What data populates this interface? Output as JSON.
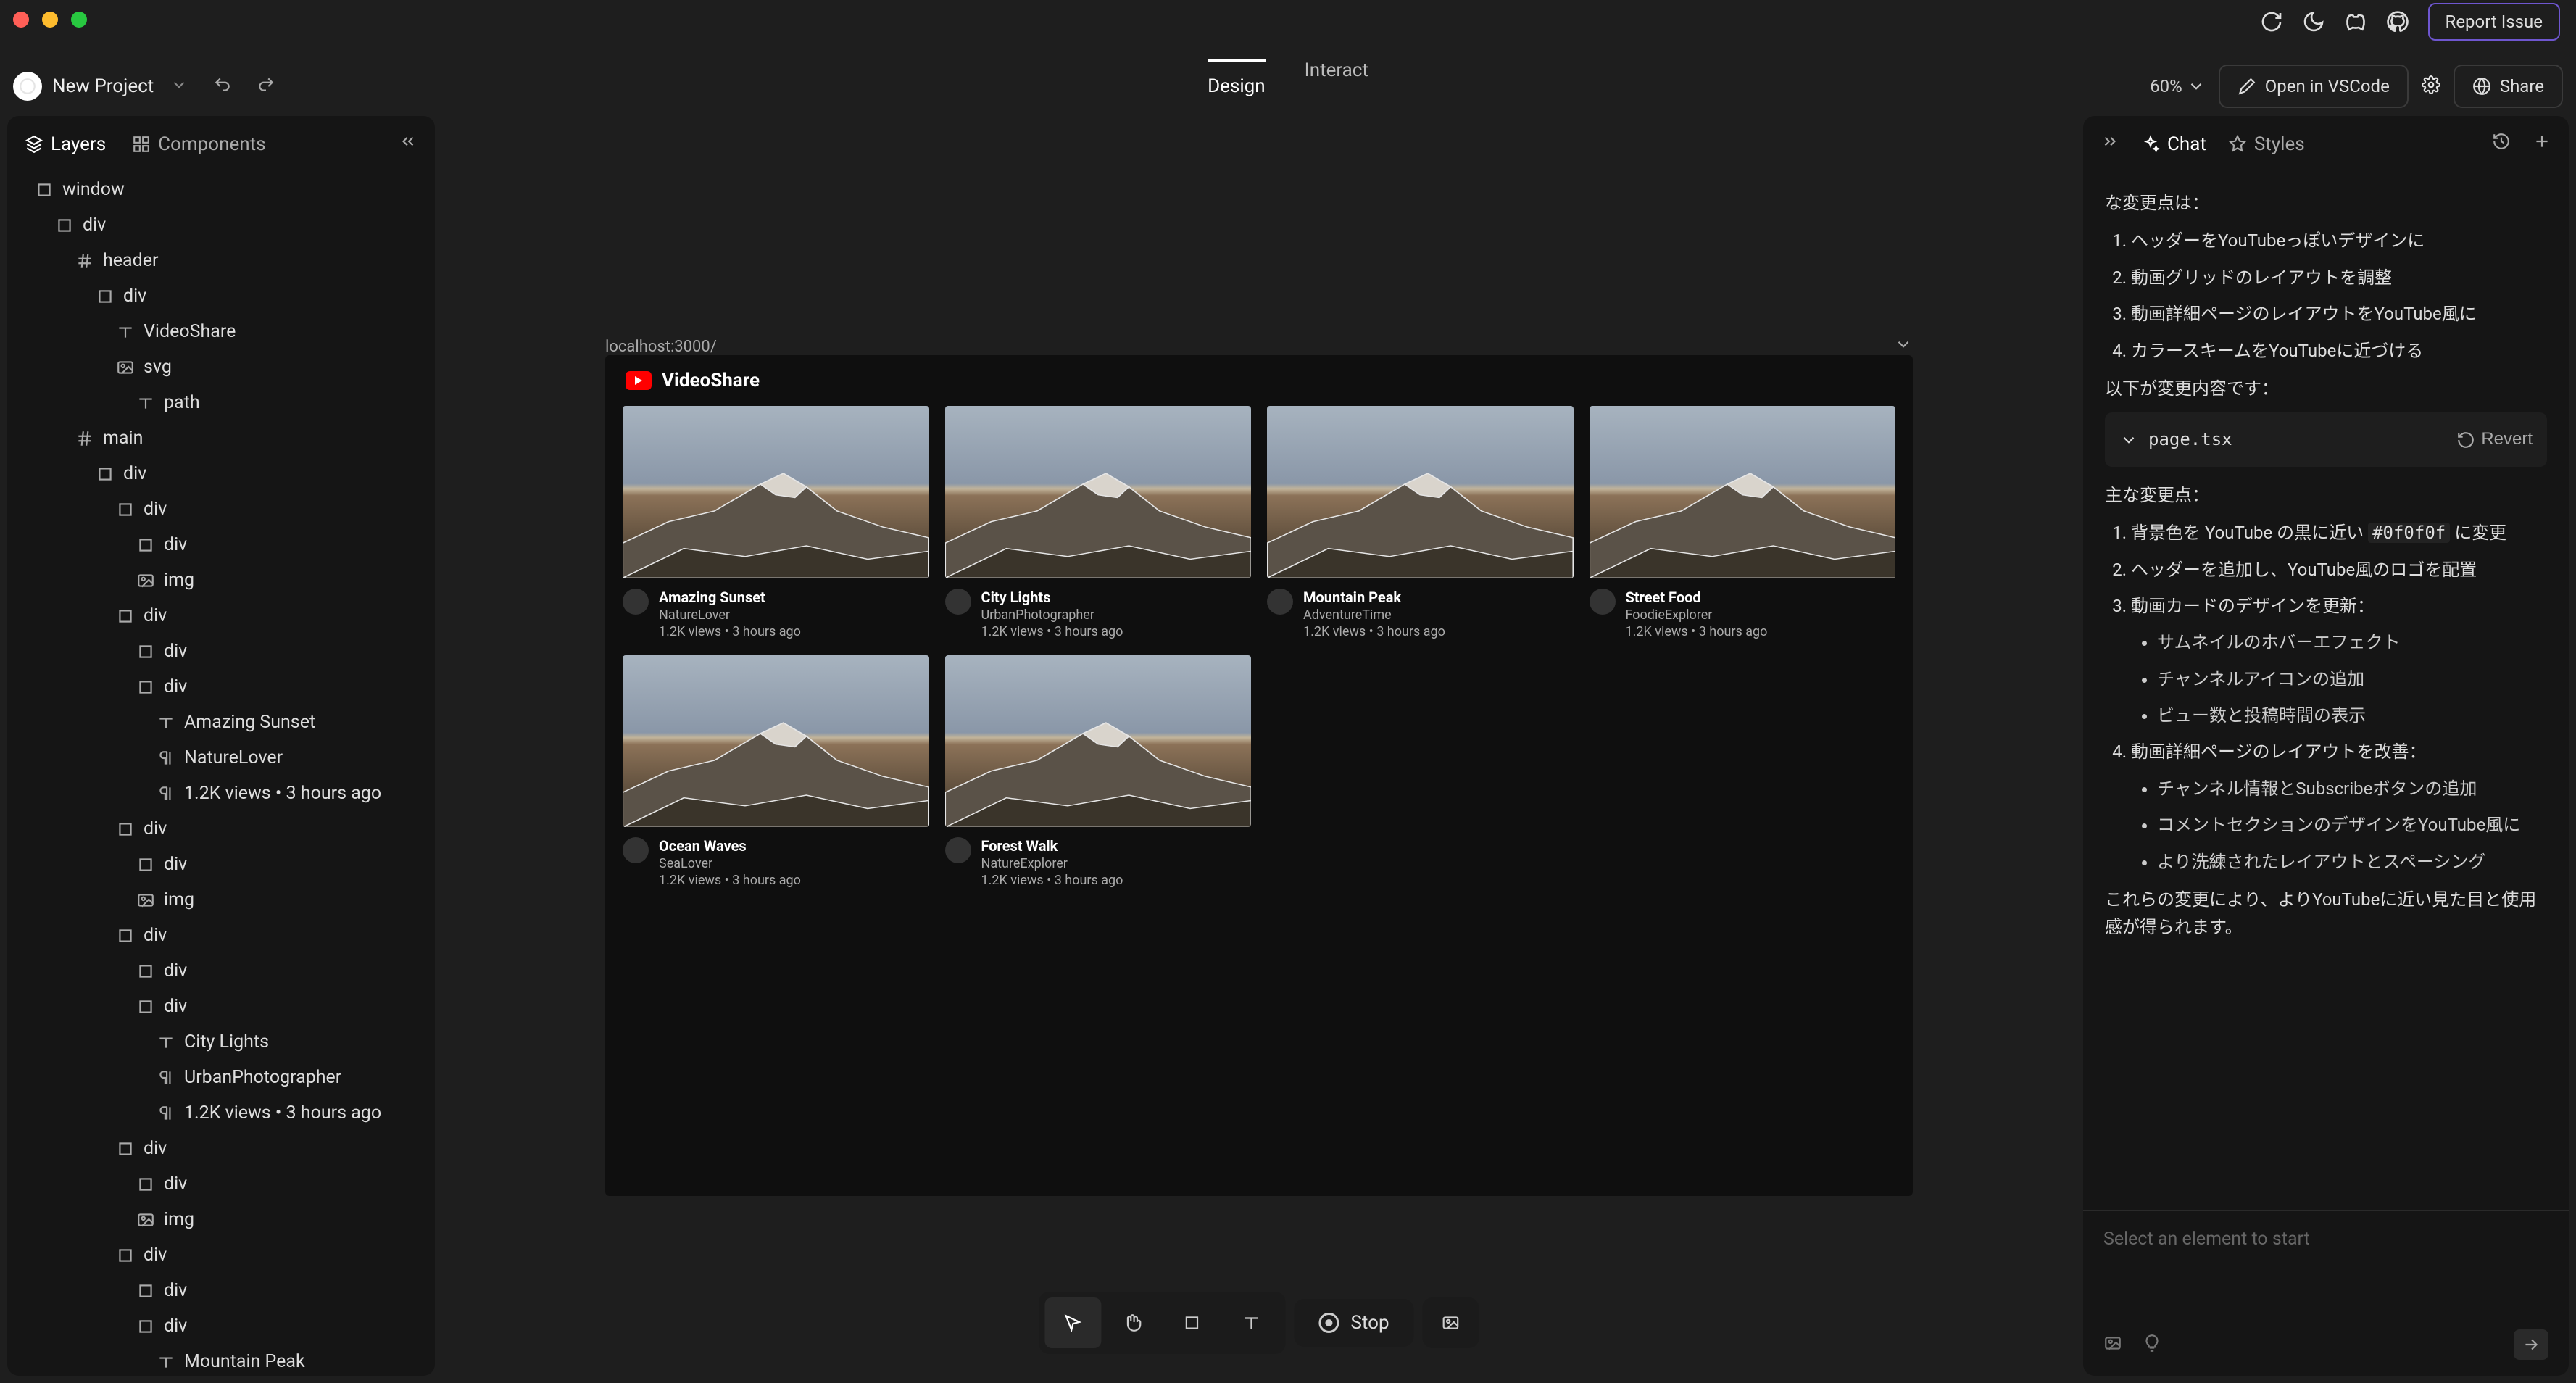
{
  "system": {
    "report_issue": "Report Issue"
  },
  "header": {
    "project_name": "New Project",
    "tabs": {
      "design": "Design",
      "interact": "Interact"
    },
    "zoom": "60%",
    "open_vscode": "Open in VSCode",
    "share": "Share"
  },
  "left_panel": {
    "tabs": {
      "layers": "Layers",
      "components": "Components"
    },
    "tree": [
      {
        "indent": 1,
        "icon": "box",
        "label": "window"
      },
      {
        "indent": 2,
        "icon": "box",
        "label": "div"
      },
      {
        "indent": 3,
        "icon": "hash",
        "label": "header"
      },
      {
        "indent": 4,
        "icon": "box",
        "label": "div"
      },
      {
        "indent": 5,
        "icon": "text",
        "label": "VideoShare"
      },
      {
        "indent": 5,
        "icon": "img",
        "label": "svg"
      },
      {
        "indent": 6,
        "icon": "text",
        "label": "path"
      },
      {
        "indent": 3,
        "icon": "hash",
        "label": "main"
      },
      {
        "indent": 4,
        "icon": "box",
        "label": "div"
      },
      {
        "indent": 5,
        "icon": "box",
        "label": "div"
      },
      {
        "indent": 6,
        "icon": "box",
        "label": "div"
      },
      {
        "indent": 6,
        "icon": "img",
        "label": "img"
      },
      {
        "indent": 5,
        "icon": "box",
        "label": "div"
      },
      {
        "indent": 6,
        "icon": "box",
        "label": "div"
      },
      {
        "indent": 6,
        "icon": "box",
        "label": "div"
      },
      {
        "indent": 7,
        "icon": "text",
        "label": "Amazing Sunset"
      },
      {
        "indent": 7,
        "icon": "para",
        "label": "NatureLover"
      },
      {
        "indent": 7,
        "icon": "para",
        "label": "1.2K views • 3 hours ago"
      },
      {
        "indent": 5,
        "icon": "box",
        "label": "div"
      },
      {
        "indent": 6,
        "icon": "box",
        "label": "div"
      },
      {
        "indent": 6,
        "icon": "img",
        "label": "img"
      },
      {
        "indent": 5,
        "icon": "box",
        "label": "div"
      },
      {
        "indent": 6,
        "icon": "box",
        "label": "div"
      },
      {
        "indent": 6,
        "icon": "box",
        "label": "div"
      },
      {
        "indent": 7,
        "icon": "text",
        "label": "City Lights"
      },
      {
        "indent": 7,
        "icon": "para",
        "label": "UrbanPhotographer"
      },
      {
        "indent": 7,
        "icon": "para",
        "label": "1.2K views • 3 hours ago"
      },
      {
        "indent": 5,
        "icon": "box",
        "label": "div"
      },
      {
        "indent": 6,
        "icon": "box",
        "label": "div"
      },
      {
        "indent": 6,
        "icon": "img",
        "label": "img"
      },
      {
        "indent": 5,
        "icon": "box",
        "label": "div"
      },
      {
        "indent": 6,
        "icon": "box",
        "label": "div"
      },
      {
        "indent": 6,
        "icon": "box",
        "label": "div"
      },
      {
        "indent": 7,
        "icon": "text",
        "label": "Mountain Peak"
      }
    ]
  },
  "canvas": {
    "url": "localhost:3000/",
    "preview": {
      "brand": "VideoShare",
      "videos": [
        {
          "title": "Amazing Sunset",
          "channel": "NatureLover",
          "stats": "1.2K views • 3 hours ago"
        },
        {
          "title": "City Lights",
          "channel": "UrbanPhotographer",
          "stats": "1.2K views • 3 hours ago"
        },
        {
          "title": "Mountain Peak",
          "channel": "AdventureTime",
          "stats": "1.2K views • 3 hours ago"
        },
        {
          "title": "Street Food",
          "channel": "FoodieExplorer",
          "stats": "1.2K views • 3 hours ago"
        },
        {
          "title": "Ocean Waves",
          "channel": "SeaLover",
          "stats": "1.2K views • 3 hours ago"
        },
        {
          "title": "Forest Walk",
          "channel": "NatureExplorer",
          "stats": "1.2K views • 3 hours ago"
        }
      ]
    }
  },
  "bottom_tools": {
    "stop": "Stop"
  },
  "right_panel": {
    "tabs": {
      "chat": "Chat",
      "styles": "Styles"
    },
    "intro": "な変更点は：",
    "list1": [
      "ヘッダーをYouTubeっぽいデザインに",
      "動画グリッドのレイアウトを調整",
      "動画詳細ページのレイアウトをYouTube風に",
      "カラースキームをYouTubeに近づける"
    ],
    "mid": "以下が変更内容です：",
    "file": "page.tsx",
    "revert": "Revert",
    "subhead": "主な変更点：",
    "list2": [
      {
        "text": "背景色を YouTube の黒に近い `#0f0f0f` に変更"
      },
      {
        "text": "ヘッダーを追加し、YouTube風のロゴを配置"
      },
      {
        "text": "動画カードのデザインを更新：",
        "sub": [
          "サムネイルのホバーエフェクト",
          "チャンネルアイコンの追加",
          "ビュー数と投稿時間の表示"
        ]
      },
      {
        "text": "動画詳細ページのレイアウトを改善：",
        "sub": [
          "チャンネル情報とSubscribeボタンの追加",
          "コメントセクションのデザインをYouTube風に",
          "より洗練されたレイアウトとスペーシング"
        ]
      }
    ],
    "outro": "これらの変更により、よりYouTubeに近い見た目と使用感が得られます。",
    "placeholder": "Select an element to start"
  }
}
